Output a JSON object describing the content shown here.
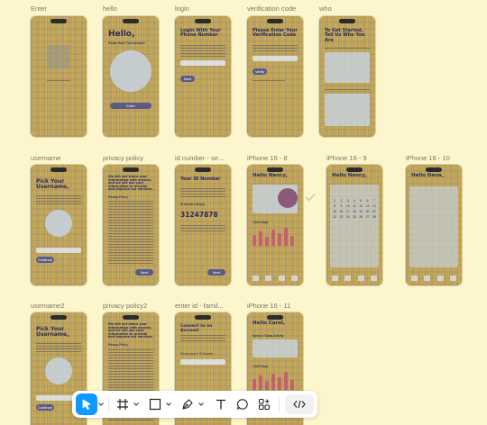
{
  "frames": [
    {
      "id": "enter",
      "label": "Enter"
    },
    {
      "id": "hello",
      "label": "hello",
      "title": "Hello,",
      "subtitle": "Please Enter Your Account",
      "button": "Enter"
    },
    {
      "id": "login",
      "label": "login",
      "title": "Login With Your Phone Number",
      "button": "Next"
    },
    {
      "id": "verification",
      "label": "verification code",
      "title": "Please Enter Your Verification Code",
      "button": "Verify"
    },
    {
      "id": "who",
      "label": "who",
      "title": "To Get Started, Tell Us Who You Are"
    },
    {
      "id": "username",
      "label": "username",
      "title": "Pick Your Username,",
      "button": "Continue"
    },
    {
      "id": "privacy",
      "label": "privacy policy",
      "title": "We will not share your information with anyone, and we will use your information to provide and improve our services.",
      "section": "Privacy Policy",
      "button": "Next"
    },
    {
      "id": "idnumber",
      "label": "id number - se...",
      "title": "Your ID Number",
      "caption": "ID Number (Pupil)",
      "number": "31247878",
      "button": "Next"
    },
    {
      "id": "iphone8",
      "label": "iPhone 16 - 8",
      "title": "Hello Nancy,",
      "stat": "1,025 steps"
    },
    {
      "id": "iphone9",
      "label": "iPhone 16 - 9",
      "title": "Hello Nancy,"
    },
    {
      "id": "iphone10",
      "label": "iPhone 16 - 10",
      "title": "Hello Dana,"
    },
    {
      "id": "username2",
      "label": "username2",
      "title": "Pick Your Username,",
      "button": "Continue"
    },
    {
      "id": "privacy2",
      "label": "privacy policy2",
      "title": "We will not share your information with anyone, and we will use your information to provide and improve our services.",
      "section": "Privacy Policy"
    },
    {
      "id": "enterid",
      "label": "enter id - famil...",
      "title": "Connect to an Account",
      "caption": "Please type in ID Number"
    },
    {
      "id": "iphone11",
      "label": "iPhone 16 - 11",
      "title": "Hello Carol,",
      "subtitle": "Nancy's Today Activity",
      "stat": "1,025 steps"
    }
  ],
  "calendar": {
    "days": [
      "1",
      "2",
      "3",
      "4",
      "5",
      "6",
      "7",
      "8",
      "9",
      "10",
      "11",
      "12",
      "13",
      "14",
      "15",
      "16",
      "17",
      "18",
      "19",
      "20",
      "21",
      "22",
      "23",
      "24",
      "25",
      "26",
      "27",
      "28"
    ]
  },
  "toolbar": {
    "tools": [
      {
        "name": "move-tool",
        "active": true
      },
      {
        "name": "frame-tool",
        "active": false
      },
      {
        "name": "shape-tool",
        "active": false
      },
      {
        "name": "pen-tool",
        "active": false
      },
      {
        "name": "text-tool",
        "active": false
      },
      {
        "name": "comment-tool",
        "active": false
      },
      {
        "name": "actions-tool",
        "active": false
      },
      {
        "name": "dev-mode-toggle",
        "active": false
      }
    ],
    "accent": "#0d99ff"
  },
  "colors": {
    "canvas": "#fdf6cc",
    "frame_title": "#2c2a5c",
    "button": "#5b5a86",
    "chart_bar": "#c0607a"
  }
}
